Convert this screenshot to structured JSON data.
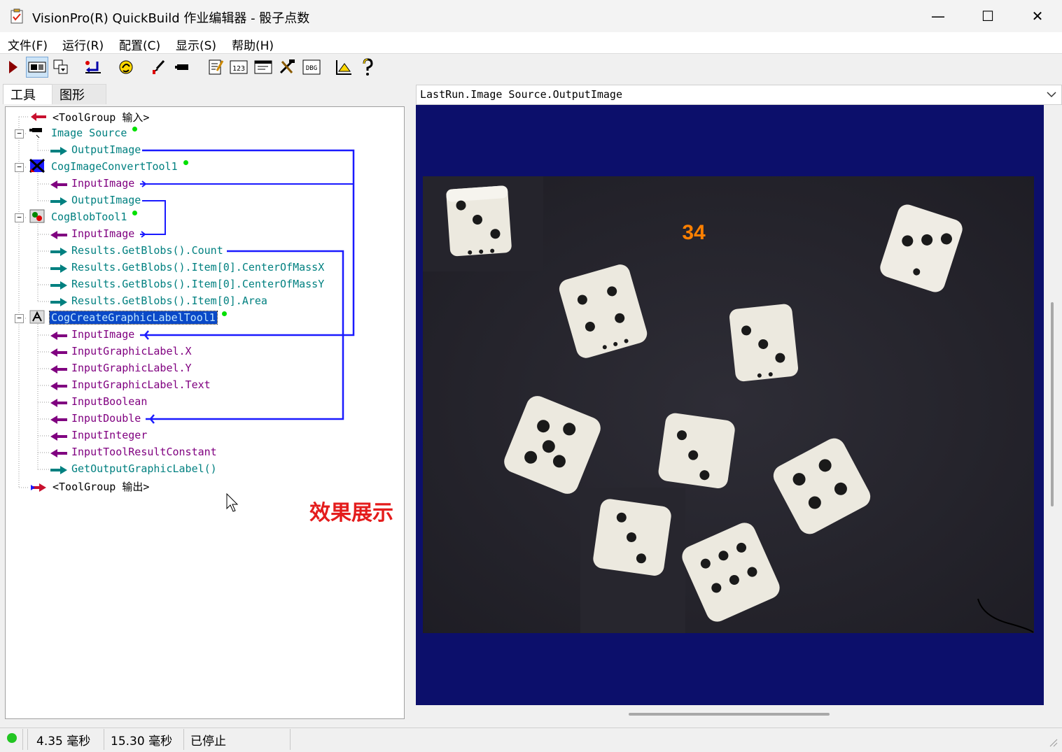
{
  "window": {
    "title": "VisionPro(R) QuickBuild 作业编辑器 - 骰子点数",
    "minimize_glyph": "—",
    "maximize_glyph": "☐",
    "close_glyph": "✕"
  },
  "menu": [
    "文件(F)",
    "运行(R)",
    "配置(C)",
    "显示(S)",
    "帮助(H)"
  ],
  "toolbar": {
    "icons": [
      "run-icon",
      "show-image-icon",
      "copy-icon",
      "reset-icon",
      "refresh-icon",
      "brush-icon",
      "camera-icon",
      "edit-icon",
      "number-icon",
      "terminal-icon",
      "tools-icon",
      "dbg-icon",
      "chart-icon",
      "help-icon"
    ],
    "labels": {
      "number": "123",
      "dbg": "DBG"
    }
  },
  "tabs": {
    "tools": "工具",
    "graphics": "图形"
  },
  "tree": {
    "group_in": "<ToolGroup 输入>",
    "image_source": "Image Source",
    "is_output": "OutputImage",
    "convert_tool": "CogImageConvertTool1",
    "ct_input": "InputImage",
    "ct_output": "OutputImage",
    "blob_tool": "CogBlobTool1",
    "bt_input": "InputImage",
    "bt_count": "Results.GetBlobs().Count",
    "bt_cx": "Results.GetBlobs().Item[0].CenterOfMassX",
    "bt_cy": "Results.GetBlobs().Item[0].CenterOfMassY",
    "bt_area": "Results.GetBlobs().Item[0].Area",
    "label_tool": "CogCreateGraphicLabelTool1",
    "lt_input": "InputImage",
    "lt_x": "InputGraphicLabel.X",
    "lt_y": "InputGraphicLabel.Y",
    "lt_text": "InputGraphicLabel.Text",
    "lt_bool": "InputBoolean",
    "lt_double": "InputDouble",
    "lt_int": "InputInteger",
    "lt_const": "InputToolResultConstant",
    "lt_get": "GetOutputGraphicLabel()",
    "group_out": "<ToolGroup 输出>"
  },
  "overlay_caption": "效果展示",
  "image_panel": {
    "selector": "LastRun.Image Source.OutputImage",
    "label_value": "34",
    "canvas_color": "#0c0f6b",
    "label_color": "#ff8000"
  },
  "statusbar": {
    "time1": "4.35 毫秒",
    "time2": "15.30 毫秒",
    "state": "已停止",
    "state_color": "#22c522"
  }
}
